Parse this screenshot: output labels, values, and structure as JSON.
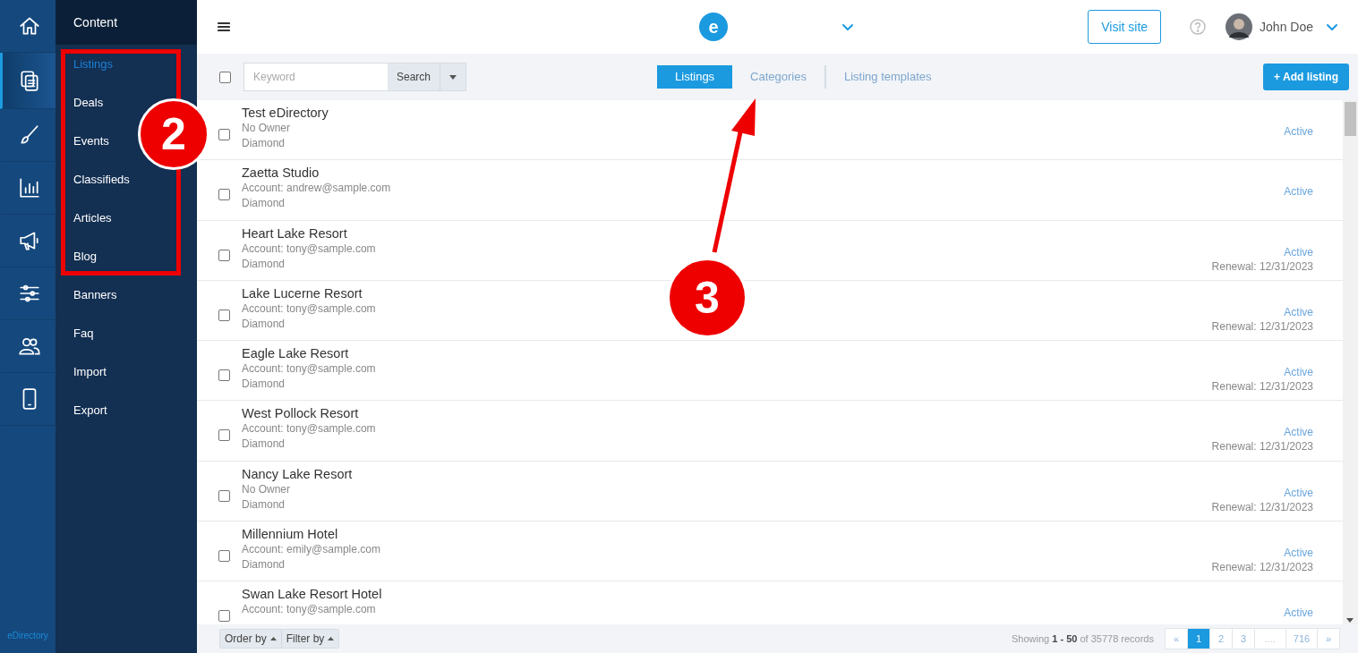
{
  "rail": {
    "items": [
      {
        "selected": false
      },
      {
        "selected": true
      },
      {
        "selected": false
      },
      {
        "selected": false
      },
      {
        "selected": false
      },
      {
        "selected": false
      },
      {
        "selected": false
      },
      {
        "selected": false
      }
    ],
    "brand": "eDirectory"
  },
  "submenu": {
    "title": "Content",
    "items": [
      {
        "label": "Listings",
        "selected": true
      },
      {
        "label": "Deals",
        "selected": false
      },
      {
        "label": "Events",
        "selected": false
      },
      {
        "label": "Classifieds",
        "selected": false
      },
      {
        "label": "Articles",
        "selected": false
      },
      {
        "label": "Blog",
        "selected": false
      },
      {
        "label": "Banners",
        "selected": false
      },
      {
        "label": "Faq",
        "selected": false
      },
      {
        "label": "Import",
        "selected": false
      },
      {
        "label": "Export",
        "selected": false
      }
    ]
  },
  "header": {
    "logo": "e",
    "visit_button": "Visit site",
    "user": "John Doe"
  },
  "toolbar": {
    "select_all": {
      "checked": false
    },
    "search": {
      "placeholder": "Keyword",
      "button": "Search"
    },
    "tabs": [
      {
        "label": "Listings",
        "selected": true
      },
      {
        "label": "Categories",
        "selected": false
      },
      {
        "label": "Listing templates",
        "selected": false
      }
    ],
    "add_button": "+ Add listing"
  },
  "rows": [
    {
      "title": "Test eDirectory",
      "owner": "No Owner",
      "level": "Diamond",
      "status": "Active",
      "checked": false
    },
    {
      "title": "Zaetta Studio",
      "owner": "Account: andrew@sample.com",
      "level": "Diamond",
      "status": "Active",
      "checked": false
    },
    {
      "title": "Heart Lake Resort",
      "owner": "Account: tony@sample.com",
      "level": "Diamond",
      "status": "Active",
      "renewal": "Renewal: 12/31/2023",
      "checked": false
    },
    {
      "title": "Lake Lucerne Resort",
      "owner": "Account: tony@sample.com",
      "level": "Diamond",
      "status": "Active",
      "renewal": "Renewal: 12/31/2023",
      "checked": false
    },
    {
      "title": "Eagle Lake Resort",
      "owner": "Account: tony@sample.com",
      "level": "Diamond",
      "status": "Active",
      "renewal": "Renewal: 12/31/2023",
      "checked": false
    },
    {
      "title": "West Pollock Resort",
      "owner": "Account: tony@sample.com",
      "level": "Diamond",
      "status": "Active",
      "renewal": "Renewal: 12/31/2023",
      "checked": false
    },
    {
      "title": "Nancy Lake Resort",
      "owner": "No Owner",
      "level": "Diamond",
      "status": "Active",
      "renewal": "Renewal: 12/31/2023",
      "checked": false
    },
    {
      "title": "Millennium Hotel",
      "owner": "Account: emily@sample.com",
      "level": "Diamond",
      "status": "Active",
      "renewal": "Renewal: 12/31/2023",
      "checked": false
    },
    {
      "title": "Swan Lake Resort Hotel",
      "owner": "Account: tony@sample.com",
      "status": "Active",
      "checked": false
    }
  ],
  "footer": {
    "order_button": "Order by",
    "filter_button": "Filter by",
    "summary": "Showing **1 - 50** of 35778 records",
    "pages": [
      {
        "label": "«",
        "selected": false
      },
      {
        "label": "1",
        "selected": true
      },
      {
        "label": "2",
        "selected": false
      },
      {
        "label": "3",
        "selected": false
      },
      {
        "label": "....",
        "selected": false
      },
      {
        "label": "716",
        "selected": false
      },
      {
        "label": "»",
        "selected": false
      }
    ]
  },
  "annotations": [
    {
      "number": "2",
      "kind": "box"
    },
    {
      "number": "3",
      "kind": "arrow"
    }
  ]
}
